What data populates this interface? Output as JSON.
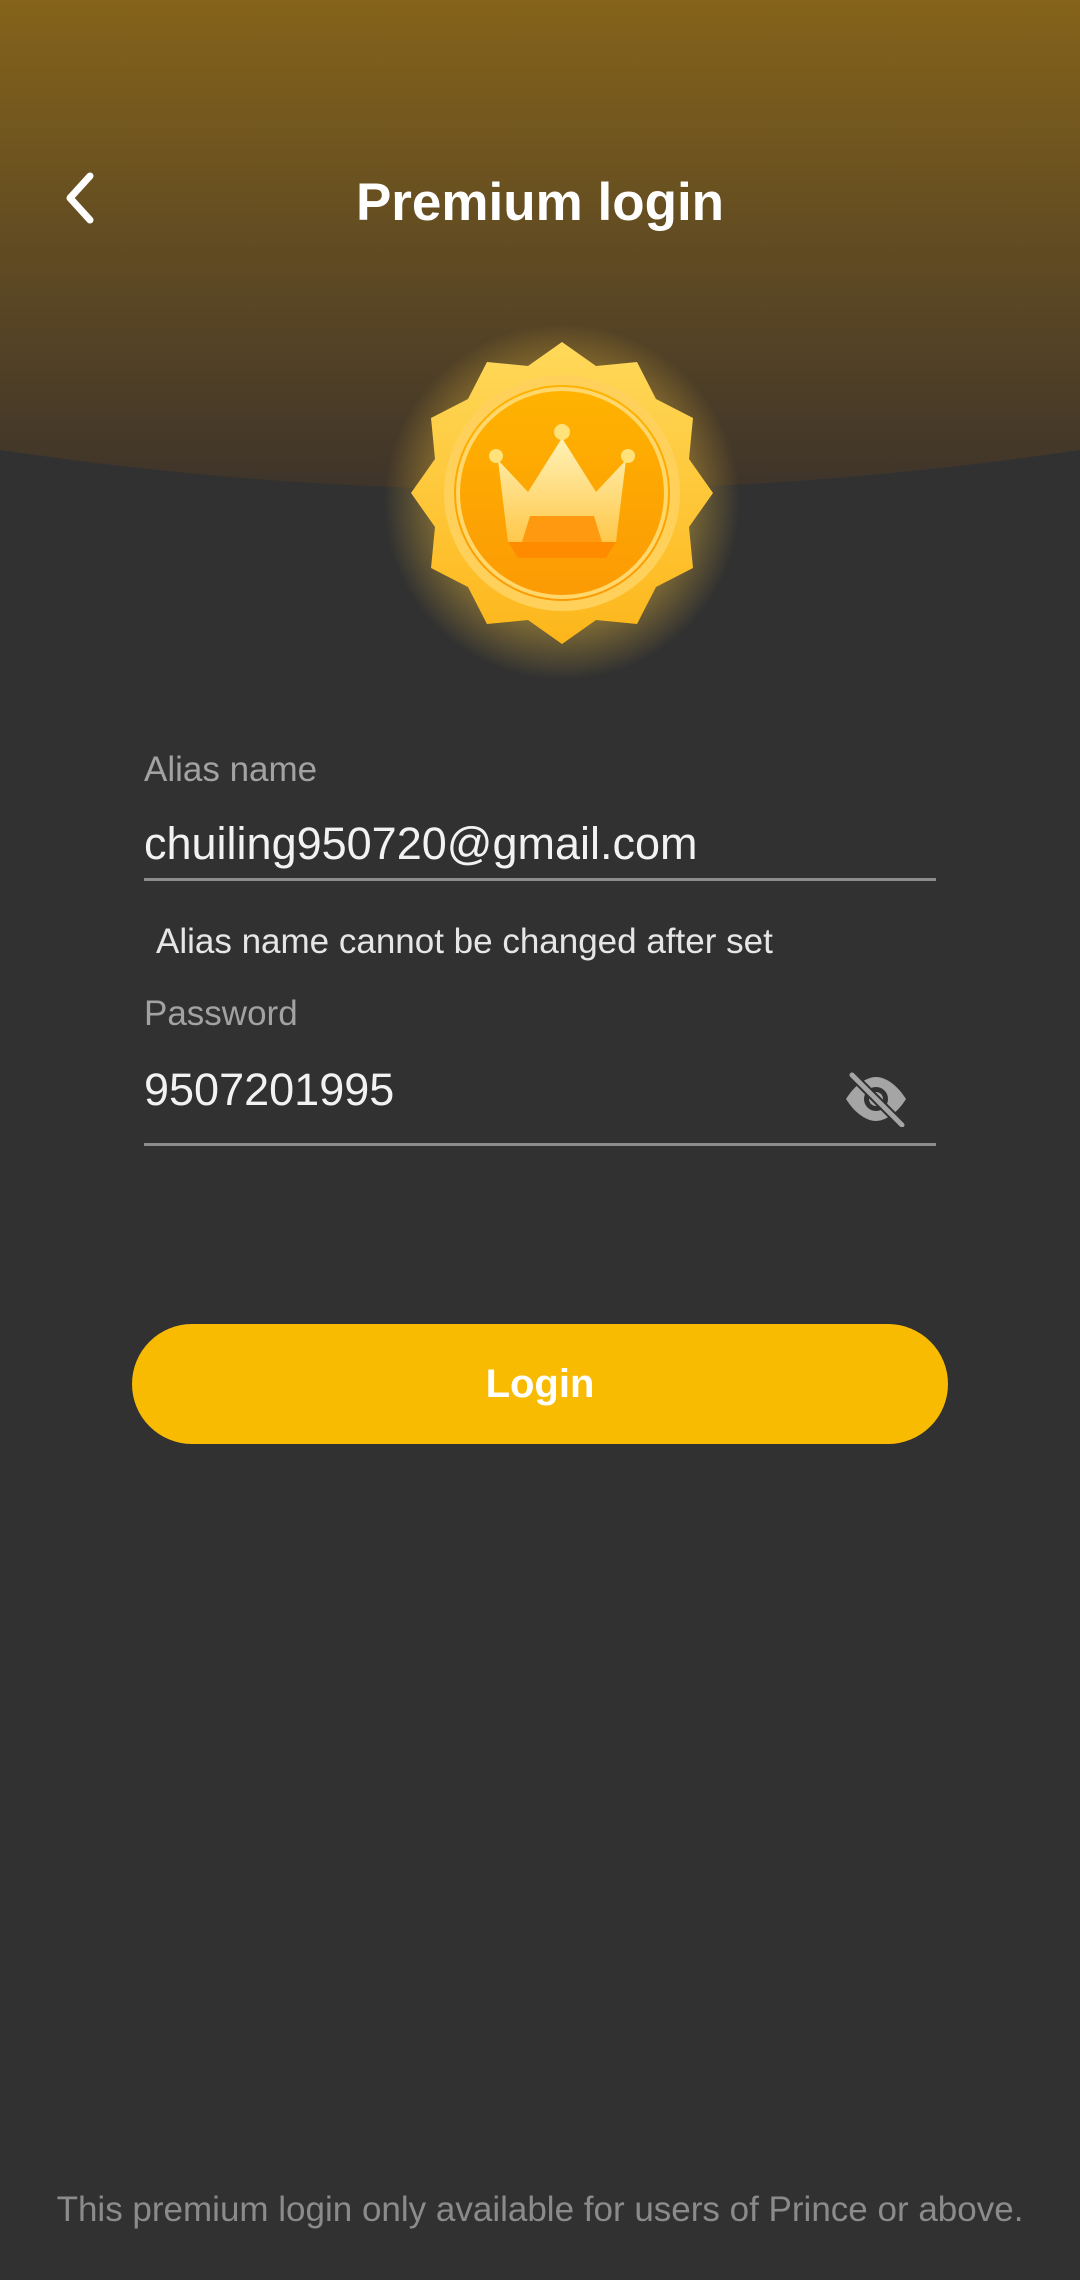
{
  "header": {
    "title": "Premium login",
    "back_icon": "chevron-left-icon",
    "gradient_top": "#84621a",
    "gradient_bottom": "#3f352a"
  },
  "badge": {
    "icon": "crown-medal-icon"
  },
  "alias_field": {
    "label": "Alias name",
    "value": "chuiling950720@gmail.com",
    "hint": "Alias name cannot be changed after set"
  },
  "password_field": {
    "label": "Password",
    "value": "9507201995",
    "visibility_icon": "eye-off-icon"
  },
  "login_button": {
    "label": "Login",
    "color": "#f8bb02"
  },
  "footer": {
    "note": "This premium login only available for users of Prince or above."
  },
  "colors": {
    "background": "#313131",
    "accent": "#f8bb02"
  }
}
